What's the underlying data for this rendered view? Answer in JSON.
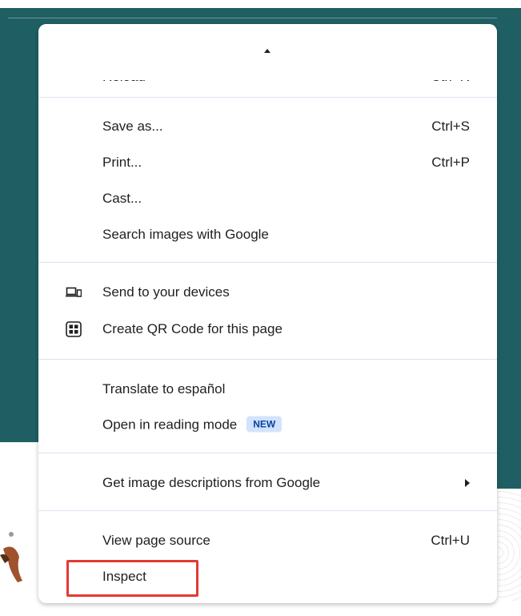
{
  "menu": {
    "partial_top_item": {
      "label": "Reload",
      "shortcut": "Ctrl+R"
    },
    "groups": [
      {
        "items": [
          {
            "label": "Save as...",
            "shortcut": "Ctrl+S"
          },
          {
            "label": "Print...",
            "shortcut": "Ctrl+P"
          },
          {
            "label": "Cast..."
          },
          {
            "label": "Search images with Google"
          }
        ]
      },
      {
        "items": [
          {
            "label": "Send to your devices",
            "icon": "devices-icon"
          },
          {
            "label": "Create QR Code for this page",
            "icon": "qr-code-icon"
          }
        ]
      },
      {
        "items": [
          {
            "label": "Translate to español"
          },
          {
            "label": "Open in reading mode",
            "badge": "NEW"
          }
        ]
      },
      {
        "items": [
          {
            "label": "Get image descriptions from Google",
            "icon": "submenu-arrow-icon"
          }
        ]
      },
      {
        "items": [
          {
            "label": "View page source",
            "shortcut": "Ctrl+U"
          },
          {
            "label": "Inspect"
          }
        ]
      }
    ]
  },
  "highlight": {
    "target": "Inspect",
    "color": "#e53935"
  },
  "colors": {
    "background_teal": "#1f5f63",
    "badge_bg": "#d3e3fd",
    "badge_text": "#0842a0",
    "separator": "#d6e2f1"
  }
}
